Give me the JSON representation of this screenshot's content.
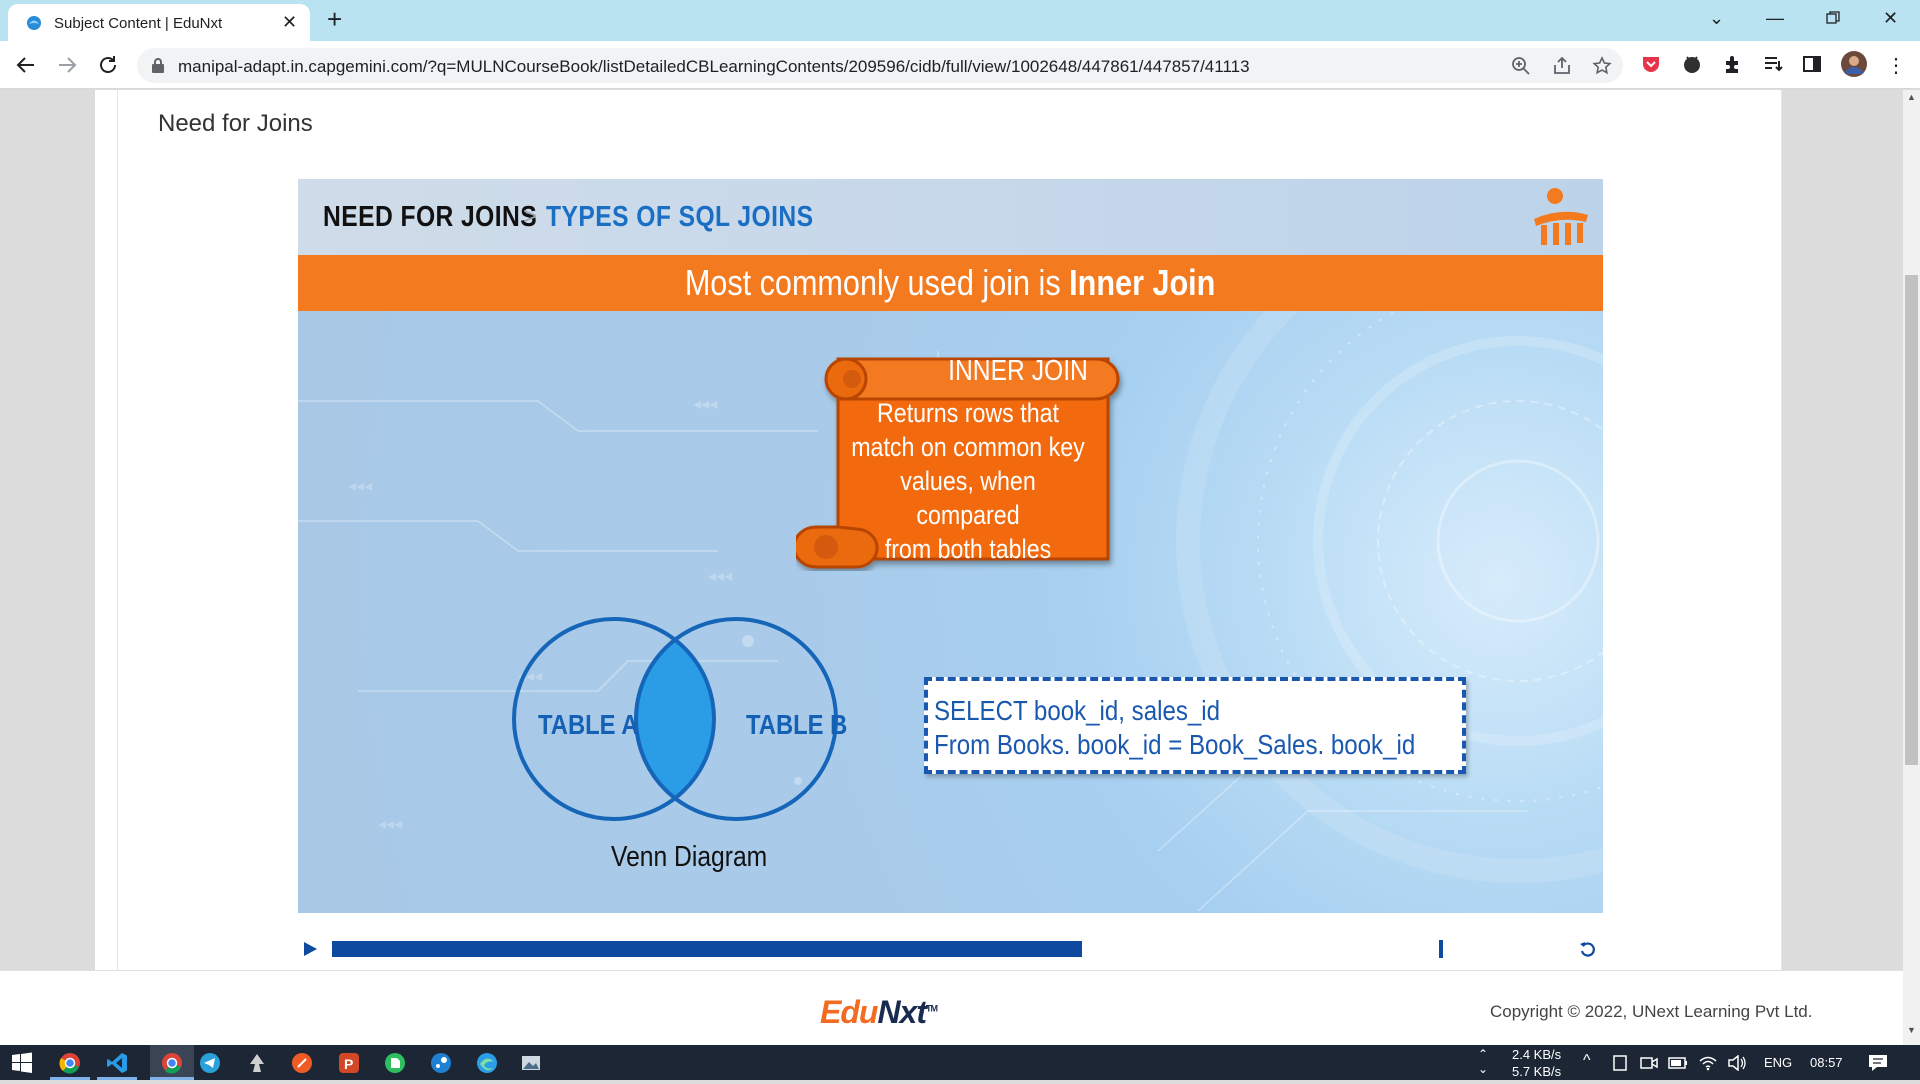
{
  "browser": {
    "tab_title": "Subject Content | EduNxt",
    "url": "manipal-adapt.in.capgemini.com/?q=MULNCourseBook/listDetailedCBLearningContents/209596/cidb/full/view/1002648/447861/447857/41113"
  },
  "page": {
    "title": "Need for Joins"
  },
  "slide": {
    "breadcrumb_current": "NEED FOR JOINS",
    "breadcrumb_separator": ">",
    "breadcrumb_next": "TYPES OF SQL JOINS",
    "banner_prefix": "Most commonly used join is ",
    "banner_emphasis": "Inner Join",
    "scroll_title": "INNER JOIN",
    "scroll_body_lines": [
      "Returns rows that",
      "match on common key",
      "values, when compared",
      "from both tables"
    ],
    "venn_left": "TABLE A",
    "venn_right": "TABLE B",
    "venn_caption": "Venn Diagram",
    "sql_lines": [
      "SELECT book_id, sales_id",
      "From Books. book_id =  Book_Sales. book_id"
    ],
    "colors": {
      "banner": "#f47a20",
      "accent_blue": "#1a6fc4",
      "venn_overlap": "#2a9de6"
    }
  },
  "player": {
    "progress_fraction": 0.6
  },
  "footer": {
    "logo_edu": "Edu",
    "logo_nxt": "Nxt",
    "logo_tm": "TM",
    "copyright": "Copyright © 2022, UNext Learning Pvt Ltd."
  },
  "taskbar": {
    "net_up": "2.4 KB/s",
    "net_down": "5.7 KB/s",
    "language": "ENG",
    "time": "08:57"
  }
}
